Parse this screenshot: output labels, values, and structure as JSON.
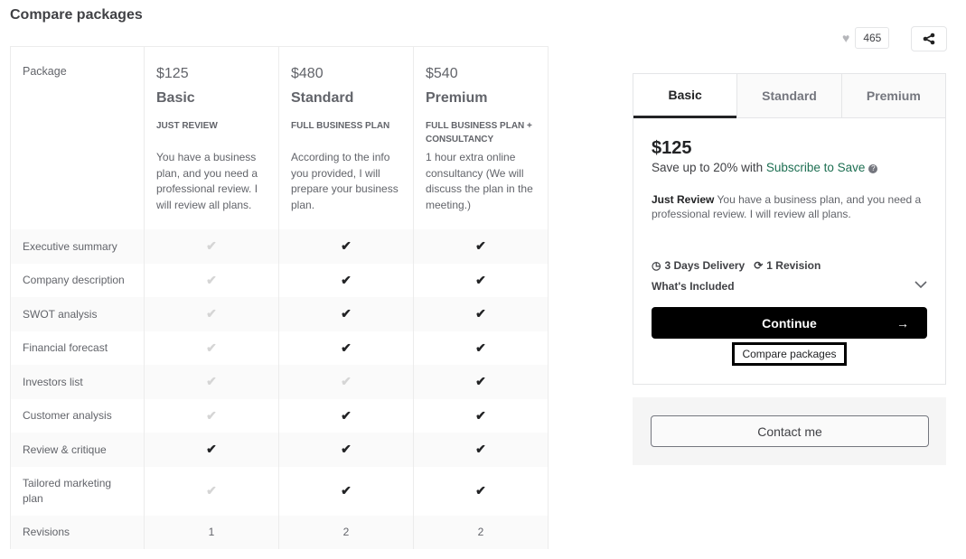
{
  "title": "Compare packages",
  "table": {
    "row_label": "Package",
    "packages": [
      {
        "price": "$125",
        "name": "Basic",
        "tag": "JUST REVIEW",
        "desc": "You have a business plan, and you need a professional review. I will review all plans."
      },
      {
        "price": "$480",
        "name": "Standard",
        "tag": "FULL BUSINESS PLAN",
        "desc": "According to the info you provided, I will prepare your business plan."
      },
      {
        "price": "$540",
        "name": "Premium",
        "tag": "FULL BUSINESS PLAN + CONSULTANCY",
        "desc": "1 hour extra online consultancy (We will discuss the plan in the meeting.)"
      }
    ],
    "features": [
      {
        "name": "Executive summary",
        "values": [
          false,
          true,
          true
        ]
      },
      {
        "name": "Company description",
        "values": [
          false,
          true,
          true
        ]
      },
      {
        "name": "SWOT analysis",
        "values": [
          false,
          true,
          true
        ]
      },
      {
        "name": "Financial forecast",
        "values": [
          false,
          true,
          true
        ]
      },
      {
        "name": "Investors list",
        "values": [
          false,
          false,
          true
        ]
      },
      {
        "name": "Customer analysis",
        "values": [
          false,
          true,
          true
        ]
      },
      {
        "name": "Review & critique",
        "values": [
          true,
          true,
          true
        ]
      },
      {
        "name": "Tailored marketing plan",
        "values": [
          false,
          true,
          true
        ]
      }
    ],
    "revisions": {
      "name": "Revisions",
      "values": [
        "1",
        "2",
        "2"
      ]
    },
    "check_glyph": "✔"
  },
  "favorites": {
    "count": "465",
    "heart_icon": "♥"
  },
  "panel": {
    "tabs": [
      "Basic",
      "Standard",
      "Premium"
    ],
    "active_tab": "Basic",
    "price": "$125",
    "save_prefix": "Save up to 20% with ",
    "save_link": "Subscribe to Save",
    "help_glyph": "?",
    "desc_title": "Just Review",
    "desc_text": " You have a business plan, and you need a professional review. I will review all plans.",
    "delivery": "3 Days Delivery",
    "revisions": "1 Revision",
    "whats_included": "What's Included",
    "continue": "Continue",
    "arrow": "→",
    "compare": "Compare packages"
  },
  "contact": "Contact me",
  "colors": {
    "accent_link": "#1d6f52",
    "primary_button": "#000000"
  }
}
